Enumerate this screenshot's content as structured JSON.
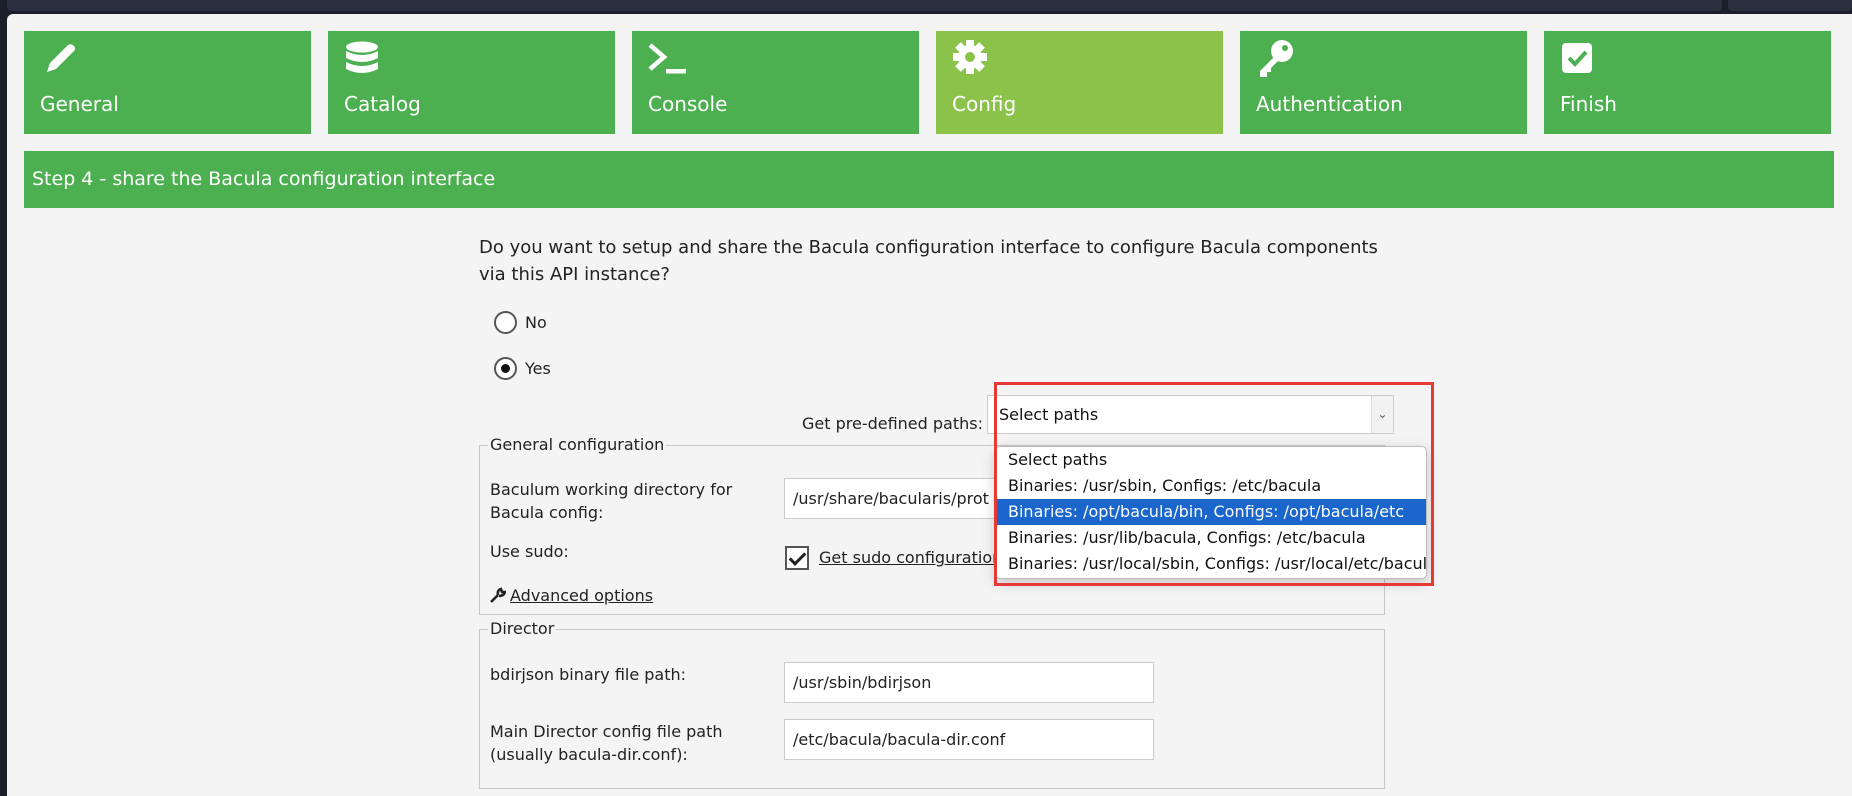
{
  "steps": [
    {
      "label": "General",
      "icon": "pencil-icon"
    },
    {
      "label": "Catalog",
      "icon": "database-icon"
    },
    {
      "label": "Console",
      "icon": "terminal-icon"
    },
    {
      "label": "Config",
      "icon": "gear-icon",
      "active": true
    },
    {
      "label": "Authentication",
      "icon": "key-icon"
    },
    {
      "label": "Finish",
      "icon": "check-square-icon"
    }
  ],
  "step_title": "Step 4 - share the Bacula configuration interface",
  "question": "Do you want to setup and share the Bacula configuration interface to configure Bacula components via this API instance?",
  "options": {
    "no": "No",
    "yes": "Yes",
    "selected": "Yes"
  },
  "paths": {
    "label": "Get pre-defined paths:",
    "selected": "Select paths",
    "choices": [
      "Select paths",
      "Binaries: /usr/sbin, Configs: /etc/bacula",
      "Binaries: /opt/bacula/bin, Configs: /opt/bacula/etc",
      "Binaries: /usr/lib/bacula, Configs: /etc/bacula",
      "Binaries: /usr/local/sbin, Configs: /usr/local/etc/bacula"
    ],
    "highlighted": "Binaries: /opt/bacula/bin, Configs: /opt/bacula/etc"
  },
  "general": {
    "legend": "General configuration",
    "workdir_label": "Baculum working directory for Bacula config:",
    "workdir_value": "/usr/share/bacularis/prot",
    "sudo_label": "Use sudo:",
    "sudo_link": "Get sudo configuration",
    "advanced": "Advanced options"
  },
  "director": {
    "legend": "Director",
    "bdirjson_label": "bdirjson binary file path:",
    "bdirjson_value": "/usr/sbin/bdirjson",
    "config_label": "Main Director config file path (usually bacula-dir.conf):",
    "config_value": "/etc/bacula/bacula-dir.conf"
  },
  "colors": {
    "step": "#4caf50",
    "active_step": "#8bc34a",
    "selection": "#1a66cc",
    "highlight": "#e53935"
  }
}
